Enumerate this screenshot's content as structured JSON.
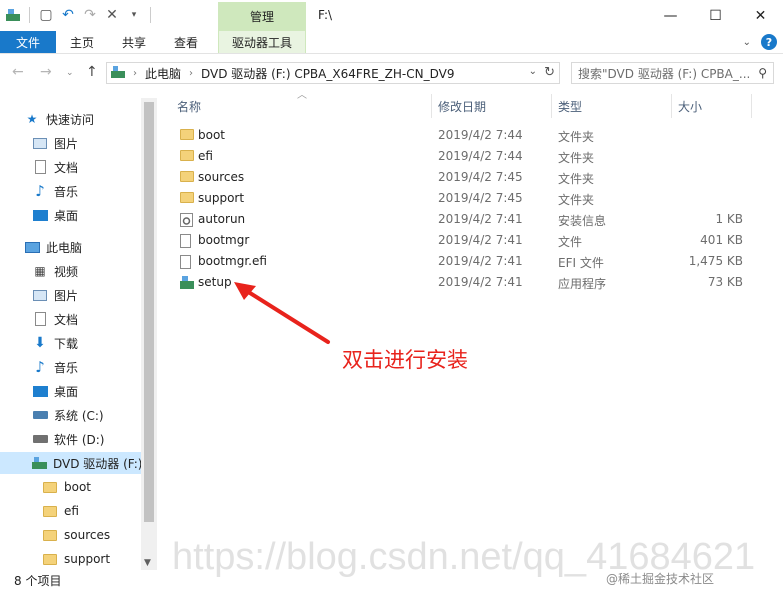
{
  "window": {
    "title": "F:\\",
    "manage_tab": "管理"
  },
  "ribbon": {
    "tabs": [
      "文件",
      "主页",
      "共享",
      "查看",
      "驱动器工具"
    ]
  },
  "address": {
    "crumbs": [
      "此电脑",
      "DVD 驱动器 (F:) CPBA_X64FRE_ZH-CN_DV9"
    ],
    "search_placeholder": "搜索\"DVD 驱动器 (F:) CPBA_..."
  },
  "sidebar": {
    "items": [
      {
        "label": "快速访问",
        "icon": "star-icon"
      },
      {
        "label": "图片",
        "icon": "pictures-icon"
      },
      {
        "label": "文档",
        "icon": "document-icon"
      },
      {
        "label": "音乐",
        "icon": "music-icon"
      },
      {
        "label": "桌面",
        "icon": "desktop-icon"
      },
      {
        "label": "此电脑",
        "icon": "computer-icon"
      },
      {
        "label": "视频",
        "icon": "video-icon"
      },
      {
        "label": "图片",
        "icon": "pictures-icon"
      },
      {
        "label": "文档",
        "icon": "document-icon"
      },
      {
        "label": "下载",
        "icon": "download-icon"
      },
      {
        "label": "音乐",
        "icon": "music-icon"
      },
      {
        "label": "桌面",
        "icon": "desktop-icon"
      },
      {
        "label": "系统 (C:)",
        "icon": "system-drive-icon"
      },
      {
        "label": "软件 (D:)",
        "icon": "drive-icon"
      },
      {
        "label": "DVD 驱动器 (F:)",
        "icon": "dvd-drive-icon"
      },
      {
        "label": "boot",
        "icon": "folder-icon"
      },
      {
        "label": "efi",
        "icon": "folder-icon"
      },
      {
        "label": "sources",
        "icon": "folder-icon"
      },
      {
        "label": "support",
        "icon": "folder-icon"
      }
    ]
  },
  "columns": {
    "name": "名称",
    "date": "修改日期",
    "type": "类型",
    "size": "大小"
  },
  "files": [
    {
      "name": "boot",
      "date": "2019/4/2 7:44",
      "type": "文件夹",
      "size": "",
      "icon": "folder-icon"
    },
    {
      "name": "efi",
      "date": "2019/4/2 7:44",
      "type": "文件夹",
      "size": "",
      "icon": "folder-icon"
    },
    {
      "name": "sources",
      "date": "2019/4/2 7:45",
      "type": "文件夹",
      "size": "",
      "icon": "folder-icon"
    },
    {
      "name": "support",
      "date": "2019/4/2 7:45",
      "type": "文件夹",
      "size": "",
      "icon": "folder-icon"
    },
    {
      "name": "autorun",
      "date": "2019/4/2 7:41",
      "type": "安装信息",
      "size": "1 KB",
      "icon": "settings-file-icon"
    },
    {
      "name": "bootmgr",
      "date": "2019/4/2 7:41",
      "type": "文件",
      "size": "401 KB",
      "icon": "file-icon"
    },
    {
      "name": "bootmgr.efi",
      "date": "2019/4/2 7:41",
      "type": "EFI 文件",
      "size": "1,475 KB",
      "icon": "file-icon"
    },
    {
      "name": "setup",
      "date": "2019/4/2 7:41",
      "type": "应用程序",
      "size": "73 KB",
      "icon": "setup-app-icon"
    }
  ],
  "annotation": "双击进行安装",
  "status": "8 个项目",
  "watermark": "https://blog.csdn.net/qq_41684621",
  "brand": "@稀土掘金技术社区",
  "colors": {
    "file_tab": "#1979ca",
    "manage_tab": "#cfe8bd",
    "selection": "#cce8ff",
    "annotation": "#e8231c"
  }
}
